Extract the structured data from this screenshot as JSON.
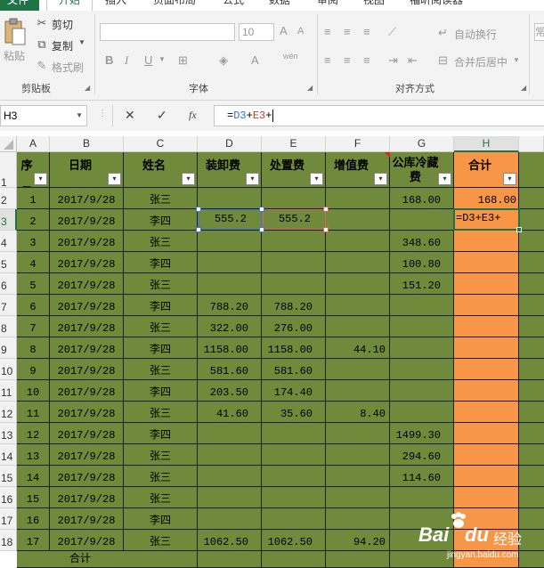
{
  "ribbon": {
    "tabs": [
      "文件",
      "开始",
      "插入",
      "页面布局",
      "公式",
      "数据",
      "审阅",
      "视图",
      "福昕阅读器"
    ],
    "clipboard": {
      "paste": "粘贴",
      "cut": "剪切",
      "copy": "复制",
      "format_painter": "格式刷",
      "group": "剪贴板"
    },
    "font": {
      "size": "10",
      "group": "字体",
      "bold": "B",
      "italic": "I",
      "underline": "U",
      "font_color": "A",
      "grow": "A",
      "shrink": "A",
      "phonetic": "wén"
    },
    "alignment": {
      "wrap_text": "自动换行",
      "merge_center": "合并后居中",
      "group": "对齐方式"
    },
    "number": {
      "format": "常"
    }
  },
  "formula_bar": {
    "name_box": "H3",
    "fx": "fx",
    "cancel": "✕",
    "enter": "✓",
    "formula_prefix": "=",
    "formula_ref1": "D3",
    "formula_plus1": "+",
    "formula_ref2": "E3",
    "formula_plus2": "+"
  },
  "sheet": {
    "columns": [
      "A",
      "B",
      "C",
      "D",
      "E",
      "F",
      "G",
      "H"
    ],
    "row_numbers": [
      "1",
      "2",
      "3",
      "4",
      "5",
      "6",
      "7",
      "8",
      "9",
      "10",
      "11",
      "12",
      "13",
      "14",
      "15",
      "16",
      "17",
      "18"
    ],
    "headers": [
      "序号",
      "日期",
      "姓名",
      "装卸费",
      "处置费",
      "增值费",
      "公库冷藏费",
      "合计"
    ],
    "filter_glyph": "▾",
    "rows": [
      [
        "1",
        "2017/9/28",
        "张三",
        "",
        "",
        "",
        "168.00",
        "168.00"
      ],
      [
        "2",
        "2017/9/28",
        "李四",
        "555.2",
        "555.2",
        "",
        "",
        "=D3+E3+"
      ],
      [
        "3",
        "2017/9/28",
        "张三",
        "",
        "",
        "",
        "348.60",
        ""
      ],
      [
        "4",
        "2017/9/28",
        "李四",
        "",
        "",
        "",
        "100.80",
        ""
      ],
      [
        "5",
        "2017/9/28",
        "张三",
        "",
        "",
        "",
        "151.20",
        ""
      ],
      [
        "6",
        "2017/9/28",
        "李四",
        "788.20",
        "788.20",
        "",
        "",
        ""
      ],
      [
        "7",
        "2017/9/28",
        "张三",
        "322.00",
        "276.00",
        "",
        "",
        ""
      ],
      [
        "8",
        "2017/9/28",
        "李四",
        "1158.00",
        "1158.00",
        "44.10",
        "",
        ""
      ],
      [
        "9",
        "2017/9/28",
        "张三",
        "581.60",
        "581.60",
        "",
        "",
        ""
      ],
      [
        "10",
        "2017/9/28",
        "李四",
        "203.50",
        "174.40",
        "",
        "",
        ""
      ],
      [
        "11",
        "2017/9/28",
        "张三",
        "41.60",
        "35.60",
        "8.40",
        "",
        ""
      ],
      [
        "12",
        "2017/9/28",
        "李四",
        "",
        "",
        "",
        "1499.30",
        ""
      ],
      [
        "13",
        "2017/9/28",
        "张三",
        "",
        "",
        "",
        "294.60",
        ""
      ],
      [
        "14",
        "2017/9/28",
        "张三",
        "",
        "",
        "",
        "114.60",
        ""
      ],
      [
        "15",
        "2017/9/28",
        "张三",
        "",
        "",
        "",
        "",
        ""
      ],
      [
        "16",
        "2017/9/28",
        "李四",
        "",
        "",
        "",
        "",
        ""
      ],
      [
        "17",
        "2017/9/28",
        "张三",
        "1062.50",
        "1062.50",
        "94.20",
        "",
        ""
      ]
    ],
    "total_label": "合计"
  },
  "watermark": {
    "brand": "Bai",
    "brand2": "经验",
    "url": "jingyan.baidu.com"
  },
  "colors": {
    "green_fill": "#6f8a3b",
    "orange_fill": "#f79646",
    "excel_green": "#217346"
  }
}
